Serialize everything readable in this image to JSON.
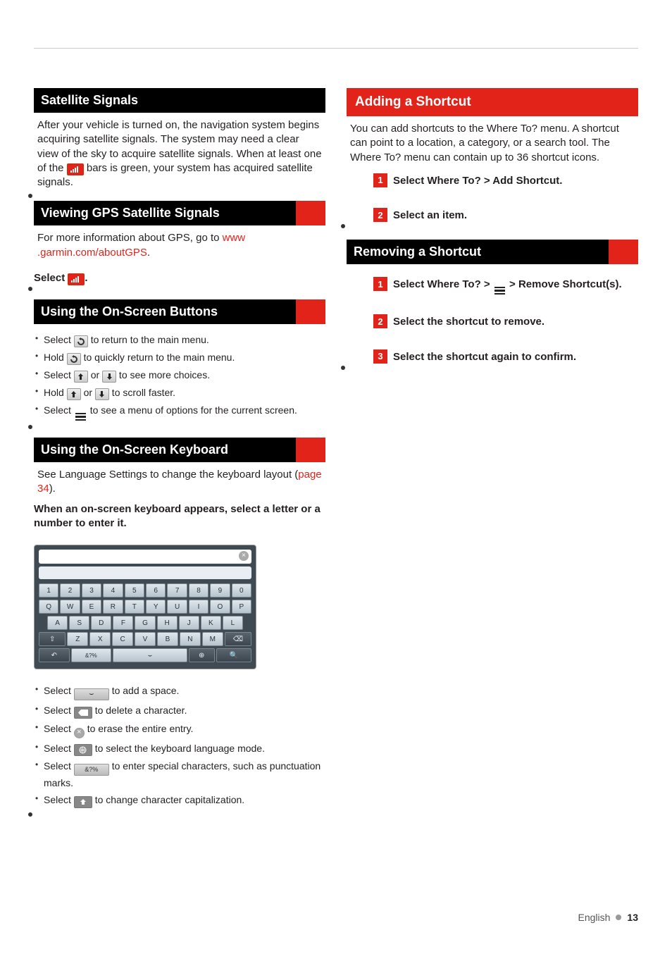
{
  "left": {
    "satellite": {
      "title": "Satellite Signals",
      "body_pre": "After your vehicle is turned on, the navigation system begins acquiring satellite signals. The system may need a clear view of the sky to acquire satellite signals. When at least one of the ",
      "body_post": " bars is green, your system has acquired satellite signals."
    },
    "viewing": {
      "title": "Viewing GPS Satellite Signals",
      "body_pre": "For more information about GPS, go to ",
      "link_a": "www",
      "link_b": ".garmin.com/aboutGPS",
      "body_post": ".",
      "step_pre": "Select ",
      "step_post": "."
    },
    "onscreen_buttons": {
      "title": "Using the On-Screen Buttons",
      "items": {
        "b1_pre": "Select ",
        "b1_post": " to return to the main menu.",
        "b2_pre": "Hold ",
        "b2_post": " to quickly return to the main menu.",
        "b3_pre": "Select ",
        "b3_mid": " or ",
        "b3_post": " to see more choices.",
        "b4_pre": "Hold ",
        "b4_mid": " or ",
        "b4_post": " to scroll faster.",
        "b5_pre": "Select ",
        "b5_post": " to see a menu of options for the current screen."
      }
    },
    "keyboard": {
      "title": "Using the On-Screen Keyboard",
      "body_pre": "See Language Settings to change the keyboard layout (",
      "link": "page 34",
      "body_post": ").",
      "step": "When an on-screen keyboard appears, select a letter or a number to enter it.",
      "keys": {
        "row1": [
          "1",
          "2",
          "3",
          "4",
          "5",
          "6",
          "7",
          "8",
          "9",
          "0"
        ],
        "row2": [
          "Q",
          "W",
          "E",
          "R",
          "T",
          "Y",
          "U",
          "I",
          "O",
          "P"
        ],
        "row3": [
          "A",
          "S",
          "D",
          "F",
          "G",
          "H",
          "J",
          "K",
          "L"
        ],
        "row4_shift": "⇧",
        "row4": [
          "Z",
          "X",
          "C",
          "V",
          "B",
          "N",
          "M"
        ],
        "row4_bksp": "⌫",
        "row5_back": "↶",
        "row5_sym": "&?%",
        "row5_space": "⌣",
        "row5_globe": "⊕",
        "row5_search": "🔍"
      },
      "items": {
        "k1_pre": "Select ",
        "k1_post": " to add a space.",
        "k2_pre": "Select ",
        "k2_post": " to delete a character.",
        "k3_pre": "Select ",
        "k3_post": " to erase the entire entry.",
        "k4_pre": "Select ",
        "k4_post": " to select the keyboard language mode.",
        "k5_pre": "Select ",
        "k5_post": " to enter special characters, such as punctuation marks.",
        "k6_pre": "Select ",
        "k6_post": " to change character capitalization."
      }
    }
  },
  "right": {
    "adding": {
      "title": "Adding a Shortcut",
      "body": "You can add shortcuts to the Where To? menu. A shortcut can point to a location, a category, or a search tool. The Where To? menu can contain up to 36 shortcut icons.",
      "steps": {
        "s1_num": "1",
        "s1": "Select Where To? > Add Shortcut.",
        "s2_num": "2",
        "s2": "Select an item."
      }
    },
    "removing": {
      "title": "Removing a Shortcut",
      "steps": {
        "s1_num": "1",
        "s1_pre": "Select Where To? > ",
        "s1_post": " > Remove Shortcut(s).",
        "s2_num": "2",
        "s2": "Select the shortcut to remove.",
        "s3_num": "3",
        "s3": "Select the shortcut again to confirm."
      }
    }
  },
  "footer": {
    "lang": "English",
    "page": "13"
  },
  "icons": {
    "bars": "▮▮▮▮",
    "back": "↶",
    "up": "↑",
    "down": "↓",
    "menu": "≡",
    "space": "⌣",
    "bksp": "⌫",
    "x": "✕",
    "globe": "⊕",
    "sym": "&?%",
    "shift": "⇧"
  }
}
